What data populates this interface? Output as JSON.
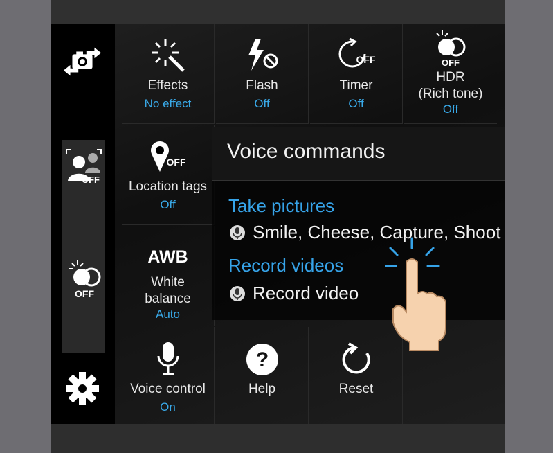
{
  "left_bar": {
    "icons": [
      "switch-camera-icon",
      "face-recognition-off-icon",
      "hdr-off-icon",
      "settings-gear-icon"
    ],
    "face_icon_badge": "OFF",
    "hdr_icon_badge": "OFF"
  },
  "settings": [
    {
      "label": "Effects",
      "value": "No effect",
      "icon": "effects-sparkle-icon"
    },
    {
      "label": "Flash",
      "value": "Off",
      "icon": "flash-off-icon"
    },
    {
      "label": "Timer",
      "value": "Off",
      "icon": "timer-off-icon",
      "badge": "OFF"
    },
    {
      "label": "HDR\n(Rich tone)",
      "value": "Off",
      "icon": "hdr-icon",
      "badge": "OFF"
    },
    {
      "label": "Location tags",
      "value": "Off",
      "icon": "location-off-icon",
      "badge": "OFF"
    },
    {
      "label": "White\nbalance",
      "value": "Auto",
      "icon": "awb-icon",
      "icon_text": "AWB"
    },
    {
      "label": "Voice control",
      "value": "On",
      "icon": "microphone-icon"
    },
    {
      "label": "Help",
      "value": "",
      "icon": "help-icon"
    },
    {
      "label": "Reset",
      "value": "",
      "icon": "reset-icon"
    }
  ],
  "popup": {
    "title": "Voice commands",
    "sections": [
      {
        "heading": "Take pictures",
        "commands": "Smile, Cheese, Capture, Shoot"
      },
      {
        "heading": "Record videos",
        "commands": "Record video"
      }
    ]
  },
  "colors": {
    "accent": "#39a9e8",
    "text": "#f2f2f2",
    "tap": "#36a3e8",
    "skin": "#f6d2ae"
  }
}
